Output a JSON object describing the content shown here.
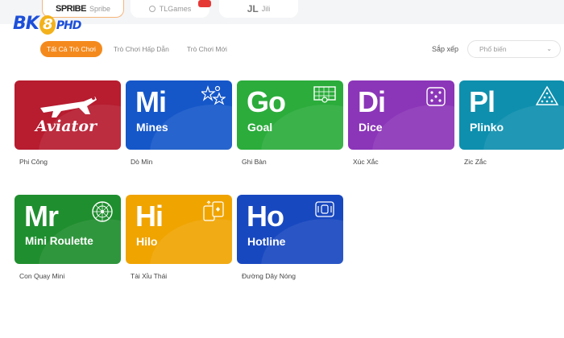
{
  "logo": {
    "text": "BK",
    "eight": "8",
    "suffix": "PHD"
  },
  "providers": [
    {
      "brand": "SPRIBE",
      "label": "Spribe"
    },
    {
      "label": "TLGames"
    },
    {
      "brand": "JL",
      "label": "Jili"
    }
  ],
  "filters": [
    "Tất Cả Trò Chơi",
    "Trò Chơi Hấp Dẫn",
    "Trò Chơi Mới"
  ],
  "sort": {
    "label": "Sắp xếp",
    "selected": "Phổ biến"
  },
  "games": [
    {
      "title": "Aviator",
      "caption": "Phi Công"
    },
    {
      "abbr": "Mi",
      "title": "Mines",
      "caption": "Dò Mìn"
    },
    {
      "abbr": "Go",
      "title": "Goal",
      "caption": "Ghi Bàn"
    },
    {
      "abbr": "Di",
      "title": "Dice",
      "caption": "Xúc Xắc"
    },
    {
      "abbr": "Pl",
      "title": "Plinko",
      "caption": "Zic Zắc"
    },
    {
      "abbr": "Mr",
      "title": "Mini Roulette",
      "caption": "Con Quay Mini"
    },
    {
      "abbr": "Hi",
      "title": "Hilo",
      "caption": "Tài Xỉu Thái"
    },
    {
      "abbr": "Ho",
      "title": "Hotline",
      "caption": "Đường Dây Nóng"
    }
  ],
  "colors": {
    "accent": "#f48a1e",
    "aviator": "#b71c2f",
    "mines": "#1557c9",
    "goal": "#2bac3b",
    "dice": "#8b35b8",
    "plinko": "#0e8fae",
    "roulette": "#1f8e2e",
    "hilo": "#f0a400",
    "hotline": "#1848c0"
  },
  "icons": [
    "stars-icon",
    "goal-net-icon",
    "dice-icon",
    "triangle-pegs-icon",
    "roulette-wheel-icon",
    "cards-icon",
    "phone-icon",
    "airplane-icon"
  ]
}
